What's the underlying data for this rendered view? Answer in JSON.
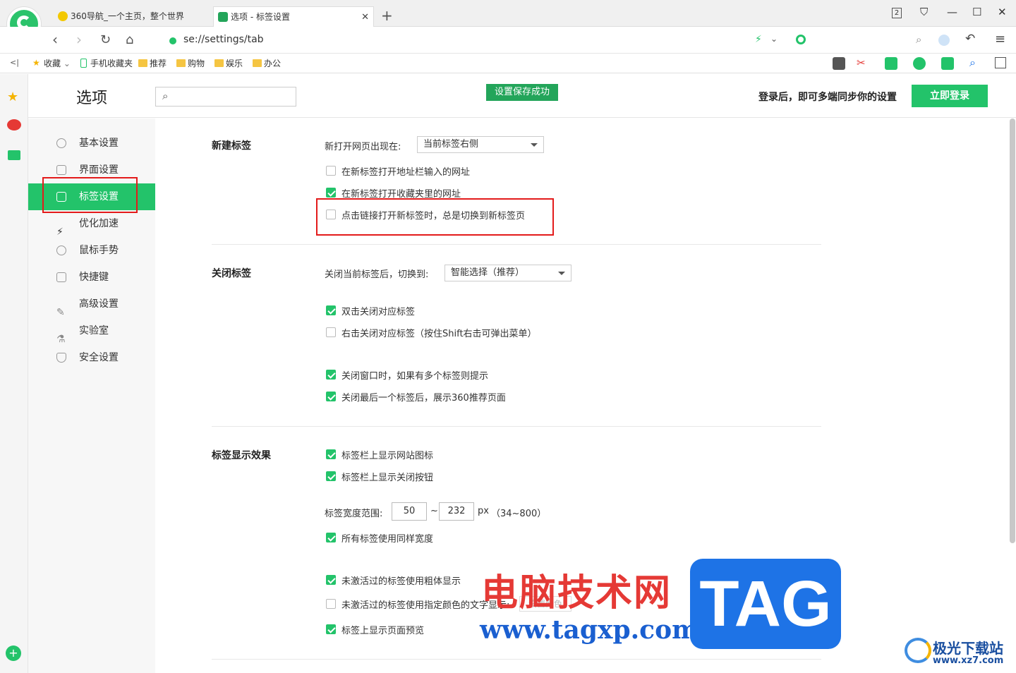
{
  "browser": {
    "tabs": [
      {
        "title": "360导航_一个主页，整个世界"
      },
      {
        "title": "选项 - 标签设置"
      }
    ],
    "new_tab_symbol": "+",
    "window_controls": {
      "tab_count": "2"
    },
    "address": "se://settings/tab",
    "bookmarks": {
      "toggle": "<|",
      "favorites": "收藏",
      "items": [
        "手机收藏夹",
        "推荐",
        "购物",
        "娱乐",
        "办公"
      ]
    }
  },
  "header": {
    "title": "选项",
    "search_placeholder": "",
    "save_toast": "设置保存成功",
    "login_prompt": "登录后，即可多端同步你的设置",
    "login_button": "立即登录"
  },
  "nav": {
    "items": [
      {
        "label": "基本设置",
        "icon": "gear-icon"
      },
      {
        "label": "界面设置",
        "icon": "window-icon"
      },
      {
        "label": "标签设置",
        "icon": "tab-icon"
      },
      {
        "label": "优化加速",
        "icon": "lightning-icon"
      },
      {
        "label": "鼠标手势",
        "icon": "mouse-icon"
      },
      {
        "label": "快捷键",
        "icon": "keyboard-icon"
      },
      {
        "label": "高级设置",
        "icon": "wrench-icon"
      },
      {
        "label": "实验室",
        "icon": "flask-icon"
      },
      {
        "label": "安全设置",
        "icon": "shield-icon"
      }
    ],
    "active_index": 2
  },
  "sections": {
    "new_tab": {
      "title": "新建标签",
      "open_position_label": "新打开网页出现在:",
      "open_position_value": "当前标签右侧",
      "options": [
        {
          "label": "在新标签打开地址栏输入的网址",
          "checked": false
        },
        {
          "label": "在新标签打开收藏夹里的网址",
          "checked": true
        },
        {
          "label": "点击链接打开新标签时，总是切换到新标签页",
          "checked": false
        }
      ]
    },
    "close_tab": {
      "title": "关闭标签",
      "switch_label": "关闭当前标签后，切换到:",
      "switch_value": "智能选择（推荐）",
      "options": [
        {
          "label": "双击关闭对应标签",
          "checked": true
        },
        {
          "label": "右击关闭对应标签（按住Shift右击可弹出菜单）",
          "checked": false
        },
        {
          "label": "关闭窗口时，如果有多个标签则提示",
          "checked": true
        },
        {
          "label": "关闭最后一个标签后，展示360推荐页面",
          "checked": true
        }
      ]
    },
    "display": {
      "title": "标签显示效果",
      "options_top": [
        {
          "label": "标签栏上显示网站图标",
          "checked": true
        },
        {
          "label": "标签栏上显示关闭按钮",
          "checked": true
        }
      ],
      "width_label": "标签宽度范围:",
      "width_min": "50",
      "width_sep": "~",
      "width_max": "232",
      "width_unit": "px",
      "width_hint": "（34~800）",
      "same_width": {
        "label": "所有标签使用同样宽度",
        "checked": true
      },
      "options_bottom": [
        {
          "label": "未激活过的标签使用粗体显示",
          "checked": true
        },
        {
          "label": "未激活过的标签使用指定颜色的文字显示:",
          "checked": false
        },
        {
          "label": "标签上显示页面预览",
          "checked": true
        }
      ],
      "color_button": "设置颜色"
    }
  },
  "watermark": {
    "cn": "电脑技术网",
    "url": "www.tagxp.com",
    "tag": "TAG",
    "jg_name": "极光下载站",
    "jg_url": "www.xz7.com"
  },
  "colors": {
    "accent": "#23c36a",
    "highlight_box": "#e31b1b"
  }
}
